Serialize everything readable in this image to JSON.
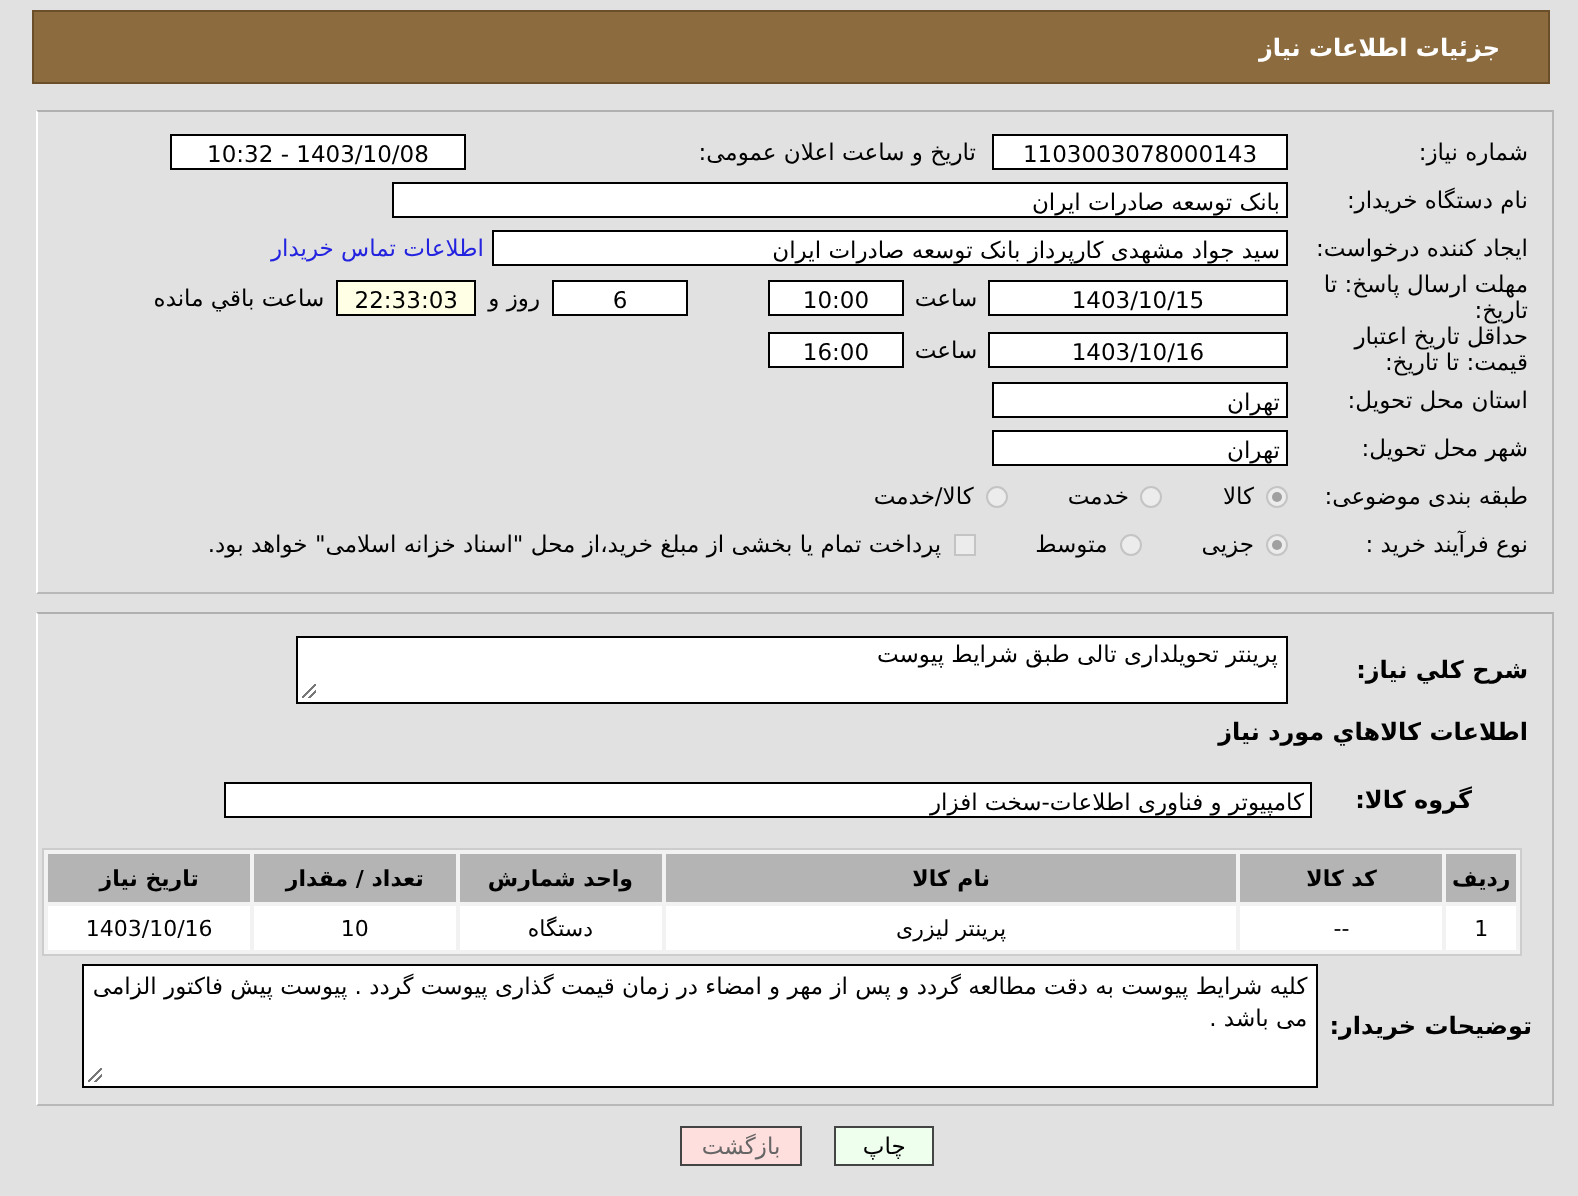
{
  "header": {
    "title": "جزئیات اطلاعات نیاز"
  },
  "need_number": {
    "label": "شماره نیاز:",
    "value": "1103003078000143"
  },
  "announce": {
    "label": "تاریخ و ساعت اعلان عمومی:",
    "value": "1403/10/08 - 10:32"
  },
  "buyer_org": {
    "label": "نام دستگاه خریدار:",
    "value": "بانک توسعه صادرات ایران"
  },
  "requester": {
    "label": "ایجاد کننده درخواست:",
    "value": "سید جواد مشهدی کارپرداز بانک توسعه صادرات ایران",
    "contact_link": "اطلاعات تماس خریدار"
  },
  "deadline": {
    "label": "مهلت ارسال پاسخ: تا تاریخ:",
    "date": "1403/10/15",
    "time_label": "ساعت",
    "time": "10:00",
    "days": "6",
    "days_label": "روز و",
    "remaining": "22:33:03",
    "remaining_label": "ساعت باقي مانده"
  },
  "validity": {
    "label": "حداقل تاریخ اعتبار قیمت: تا تاریخ:",
    "date": "1403/10/16",
    "time_label": "ساعت",
    "time": "16:00"
  },
  "province": {
    "label": "استان محل تحویل:",
    "value": "تهران"
  },
  "city": {
    "label": "شهر محل تحویل:",
    "value": "تهران"
  },
  "category": {
    "label": "طبقه بندی موضوعی:",
    "options": [
      {
        "label": "کالا",
        "selected": true
      },
      {
        "label": "خدمت",
        "selected": false
      },
      {
        "label": "کالا/خدمت",
        "selected": false
      }
    ]
  },
  "process": {
    "label": "نوع فرآیند خرید :",
    "options": [
      {
        "label": "جزیی",
        "selected": true
      },
      {
        "label": "متوسط",
        "selected": false
      }
    ],
    "treasury": {
      "checked": false,
      "text": "پرداخت تمام یا بخشی از مبلغ خرید،از محل \"اسناد خزانه اسلامی\" خواهد بود."
    }
  },
  "description": {
    "label": "شرح كلي نياز:",
    "value": "پرینتر تحویلداری تالی طبق شرایط پیوست"
  },
  "goods_heading": "اطلاعات كالاهاي مورد نياز",
  "goods_group": {
    "label": "گروه کالا:",
    "value": "کامپیوتر و فناوری اطلاعات-سخت افزار"
  },
  "table": {
    "columns": [
      "ردیف",
      "کد کالا",
      "نام کالا",
      "واحد شمارش",
      "تعداد / مقدار",
      "تاریخ نیاز"
    ],
    "rows": [
      [
        "1",
        "--",
        "پرینتر لیزری",
        "دستگاه",
        "10",
        "1403/10/16"
      ]
    ]
  },
  "buyer_notes": {
    "label": "توضیحات خریدار:",
    "value": "کلیه شرایط پیوست به دقت مطالعه گردد و پس از مهر و امضاء در زمان قیمت گذاری پیوست گردد . پیوست پیش فاکتور الزامی می باشد ."
  },
  "buttons": [
    {
      "label": "چاپ",
      "kind": "print"
    },
    {
      "label": "بازگشت",
      "kind": "back"
    }
  ]
}
